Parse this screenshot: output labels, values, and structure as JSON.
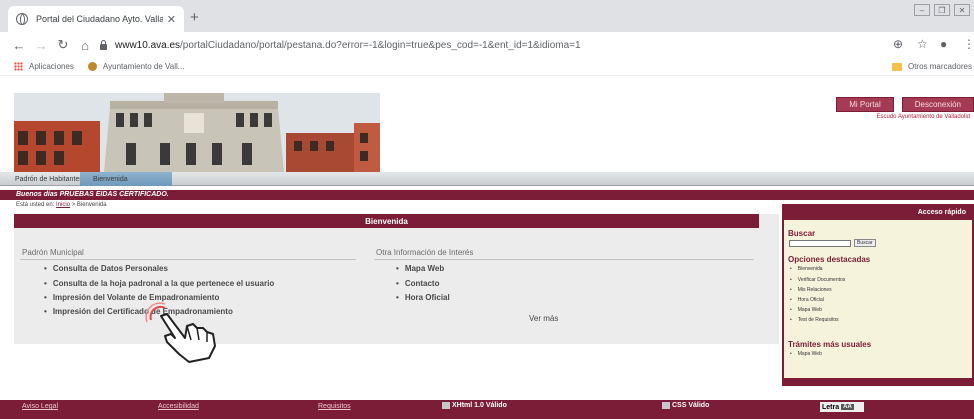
{
  "browser": {
    "tab_title": "Portal del Ciudadano Ayto. Vallado...",
    "tab_close": "✕",
    "new_tab": "+",
    "url_host": "www10.ava.es",
    "url_path": "/portalCiudadano/portal/pestana.do?error=-1&login=true&pes_cod=-1&ent_id=1&idioma=1",
    "bookmarks": [
      {
        "label": "Aplicaciones",
        "icon": "apps-grid-icon"
      },
      {
        "label": "Ayuntamiento de Vall..."
      }
    ],
    "other_bookmarks": "Otros marcadores"
  },
  "header": {
    "mi_portal": "Mi Portal",
    "desconexion": "Desconexión",
    "subtitle": "Escudo Ayuntamiento de Valladolid"
  },
  "site_tabs": [
    "Padrón de Habitantes",
    "Bienvenida"
  ],
  "greeting": "Buenos días PRUEBAS EIDAS CERTIFICADO.",
  "breadcrumb": {
    "prefix": "Está usted en:",
    "home": "Inicio",
    "current": "> Bienvenida"
  },
  "main": {
    "title": "Bienvenida",
    "padron": {
      "title": "Padrón Municipal",
      "links": [
        "Consulta de Datos Personales",
        "Consulta de la hoja padronal a la que pertenece el usuario",
        "Impresión del Volante de Empadronamiento",
        "Impresión del Certificado de Empadronamiento"
      ]
    },
    "otra": {
      "title": "Otra Información de Interés",
      "links": [
        "Mapa Web",
        "Contacto",
        "Hora Oficial"
      ]
    },
    "ver_mas": "Ver más"
  },
  "sidebar": {
    "header": "Acceso rápido",
    "buscar": "Buscar",
    "buscar_btn": "Buscar",
    "destacadas_title": "Opciones destacadas",
    "destacadas": [
      "Bienvenida",
      "Verificar Documentos",
      "Mis Relaciones",
      "Hora Oficial",
      "Mapa Web",
      "Test de Requisitos"
    ],
    "tramites_title": "Trámites más usuales",
    "tramites": [
      "Mapa Web"
    ]
  },
  "footer": {
    "links": [
      "Aviso Legal",
      "Accesibilidad",
      "Requisitos"
    ],
    "badges": [
      "XHtml 1.0 Válido",
      "CSS Válido"
    ],
    "access_label": "Letra",
    "access_aa": "AA"
  },
  "colors": {
    "accent": "#7c1d37",
    "sidebar_bg": "#f6f3dc",
    "main_bg": "#ececec"
  }
}
